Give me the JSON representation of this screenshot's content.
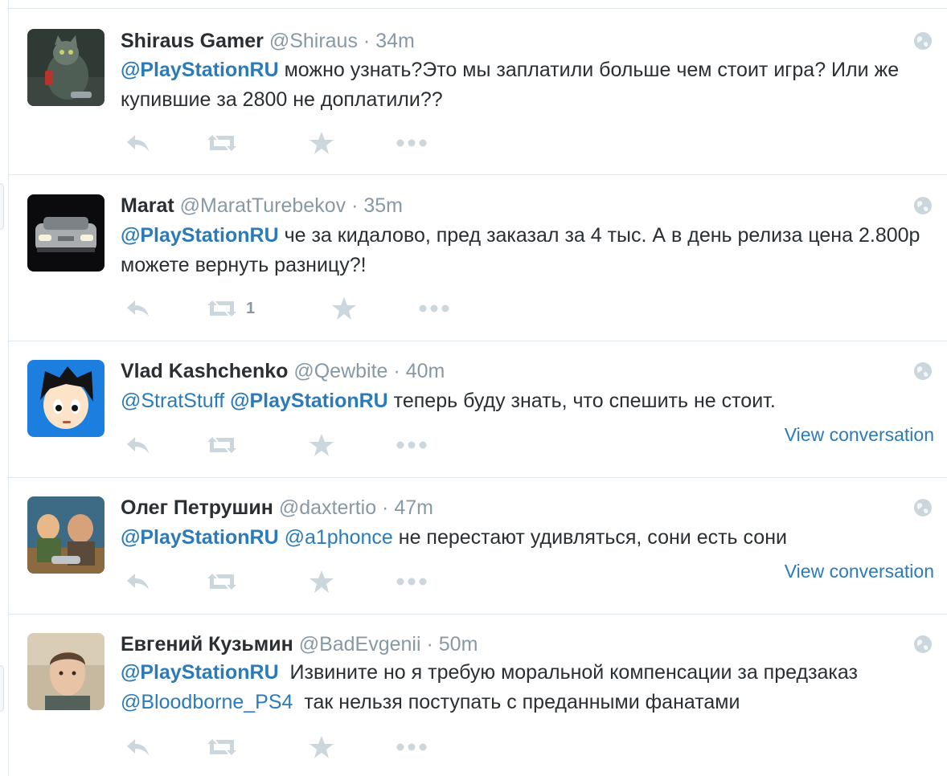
{
  "colors": {
    "link": "#2b7bb9",
    "muted": "#8899a6",
    "icon": "#ccd6dd",
    "text": "#292f33"
  },
  "icons": [
    "reply-icon",
    "retweet-icon",
    "favorite-icon",
    "more-icon",
    "globe-icon"
  ],
  "tweets": [
    {
      "fullname": "Shiraus Gamer",
      "username": "@Shiraus",
      "sep": "·",
      "time": "34m",
      "mention1": "@PlayStationRU",
      "text1": " можно узнать?Это мы заплатили больше чем стоит игра? Или же купившие за 2800 не доплатили??"
    },
    {
      "fullname": "Marat",
      "username": "@MaratTurebekov",
      "sep": "·",
      "time": "35m",
      "mention1": "@PlayStationRU",
      "text1": " че за кидалово, пред заказал за 4 тыс. А в день релиза цена 2.800р можете вернуть разницу?!",
      "retweet_count": "1"
    },
    {
      "fullname": "Vlad Kashchenko",
      "username": "@Qewbite",
      "sep": "·",
      "time": "40m",
      "mention0": "@StratStuff",
      "mention1": "@PlayStationRU",
      "text1": " теперь буду знать, что спешить не стоит.",
      "view_conversation": "View conversation"
    },
    {
      "fullname": "Олег Петрушин",
      "username": "@daxtertio",
      "sep": "·",
      "time": "47m",
      "mention1": "@PlayStationRU",
      "mention2": "@a1phonce",
      "text1": " не перестают удивляться, сони есть сони",
      "view_conversation": "View conversation"
    },
    {
      "fullname": "Евгений Кузьмин",
      "username": "@BadEvgenii",
      "sep": "·",
      "time": "50m",
      "mention1": "@PlayStationRU",
      "text1": "  Извините но я требую моральной компенсации за предзаказ ",
      "mention2": "@Bloodborne_PS4",
      "text2": "  так нельзя поступать с преданными фанатами"
    }
  ]
}
